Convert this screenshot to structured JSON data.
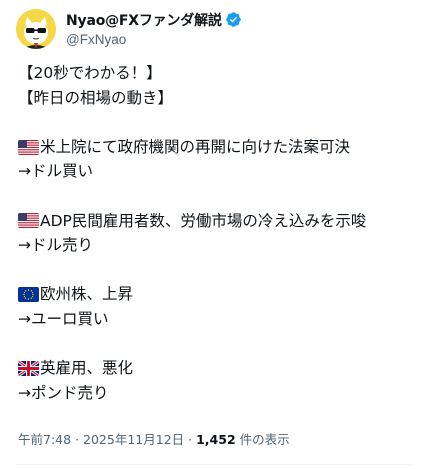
{
  "author": {
    "display_name": "Nyao@FXファンダ解説",
    "handle": "@FxNyao",
    "verified_icon": "verified-badge-icon",
    "colors": {
      "verified": "#1d9bf0",
      "avatar_bg": "#f7d93a"
    }
  },
  "tweet": {
    "lines": [
      {
        "flag": "",
        "text": "【20秒でわかる！】"
      },
      {
        "flag": "",
        "text": "【昨日の相場の動き】"
      },
      {
        "flag": "",
        "text": ""
      },
      {
        "flag": "us-flag-icon",
        "text": "米上院にて政府機関の再開に向けた法案可決"
      },
      {
        "flag": "",
        "text": "→ドル買い"
      },
      {
        "flag": "",
        "text": ""
      },
      {
        "flag": "us-flag-icon",
        "text": "ADP民間雇用者数、労働市場の冷え込みを示唆"
      },
      {
        "flag": "",
        "text": "→ドル売り"
      },
      {
        "flag": "",
        "text": ""
      },
      {
        "flag": "eu-flag-icon",
        "text": "欧州株、上昇"
      },
      {
        "flag": "",
        "text": "→ユーロ買い"
      },
      {
        "flag": "",
        "text": ""
      },
      {
        "flag": "uk-flag-icon",
        "text": "英雇用、悪化"
      },
      {
        "flag": "",
        "text": "→ポンド売り"
      }
    ]
  },
  "meta": {
    "time": "午前7:48",
    "separator": "·",
    "date": "2025年11月12日",
    "views_count": "1,452",
    "views_label": "件の表示"
  }
}
